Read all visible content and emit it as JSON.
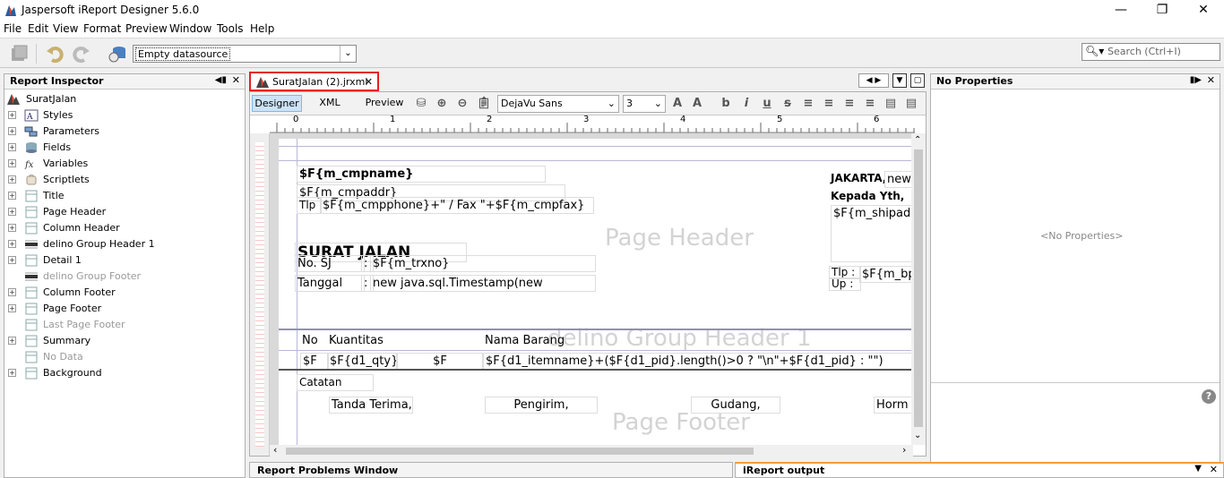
{
  "app": {
    "title": "Jaspersoft iReport Designer 5.6.0"
  },
  "window_controls": {
    "minimize": "—",
    "maximize": "❐",
    "close": "✕"
  },
  "menu": [
    "File",
    "Edit",
    "View",
    "Format",
    "Preview",
    "Window",
    "Tools",
    "Help"
  ],
  "toolbar": {
    "datasource": "Empty datasource"
  },
  "search": {
    "placeholder": "Search (Ctrl+I)"
  },
  "inspector": {
    "title": "Report Inspector",
    "root": "SuratJalan",
    "items": [
      {
        "label": "Styles",
        "icon": "styles-icon",
        "disabled": false
      },
      {
        "label": "Parameters",
        "icon": "parameters-icon",
        "disabled": false
      },
      {
        "label": "Fields",
        "icon": "fields-icon",
        "disabled": false
      },
      {
        "label": "Variables",
        "icon": "variables-icon",
        "disabled": false
      },
      {
        "label": "Scriptlets",
        "icon": "scriptlets-icon",
        "disabled": false
      },
      {
        "label": "Title",
        "icon": "band-icon",
        "disabled": false
      },
      {
        "label": "Page Header",
        "icon": "band-icon",
        "disabled": false
      },
      {
        "label": "Column Header",
        "icon": "band-icon",
        "disabled": false
      },
      {
        "label": "delino Group Header 1",
        "icon": "group-band-icon",
        "disabled": false
      },
      {
        "label": "Detail 1",
        "icon": "band-icon",
        "disabled": false
      },
      {
        "label": "delino Group Footer",
        "icon": "group-band-icon",
        "disabled": true
      },
      {
        "label": "Column Footer",
        "icon": "band-icon",
        "disabled": false
      },
      {
        "label": "Page Footer",
        "icon": "band-icon",
        "disabled": false
      },
      {
        "label": "Last Page Footer",
        "icon": "band-icon",
        "disabled": true
      },
      {
        "label": "Summary",
        "icon": "band-icon",
        "disabled": false
      },
      {
        "label": "No Data",
        "icon": "band-icon",
        "disabled": true
      },
      {
        "label": "Background",
        "icon": "band-icon",
        "disabled": false
      }
    ]
  },
  "editor": {
    "tab": "SuratJalan (2).jrxml",
    "views": [
      "Designer",
      "XML",
      "Preview"
    ],
    "font_family": "DejaVu Sans",
    "font_size": "3",
    "ruler_marks": [
      "0",
      "1",
      "2",
      "3",
      "4",
      "5",
      "6"
    ]
  },
  "design": {
    "bands": {
      "page_header": "Page Header",
      "group_header": "delino Group Header 1",
      "page_footer": "Page Footer"
    },
    "fields": {
      "cmpname": "$F{m_cmpname}",
      "cmpaddr": "$F{m_cmpaddr}",
      "tlp_label": "Tlp :",
      "cmpphone": "$F{m_cmpphone}+\" / Fax \"+$F{m_cmpfax}",
      "jakarta": "JAKARTA,",
      "jakarta_new": "new",
      "kepada": "Kepada Yth,",
      "shipaddr": "$F{m_shipadd",
      "title": "SURAT JALAN",
      "no_sj_label": "No. SJ",
      "colon1": ":",
      "trxno": "$F{m_trxno}",
      "tanggal_label": "Tanggal",
      "colon2": ":",
      "timestamp": "new java.sql.Timestamp(new",
      "tlp2": "Tlp :",
      "up": "Up :",
      "bp": "$F{m_bp",
      "col_no": "No",
      "col_qty": "Kuantitas",
      "col_item": "Nama Barang",
      "d_no": "$F",
      "d_qty": "$F{d1_qty}",
      "d_f": "$F",
      "d_item": "$F{d1_itemname}+($F{d1_pid}.length()>0 ? \"\\n\"+$F{d1_pid} : \"\")",
      "catatan": "Catatan",
      "tanda": "Tanda Terima,",
      "pengirim": "Pengirim,",
      "gudang": "Gudang,",
      "hormat": "Horm"
    }
  },
  "properties": {
    "title": "No Properties",
    "empty": "<No Properties>"
  },
  "bottom": {
    "problems": "Report Problems Window",
    "output": "iReport output"
  }
}
